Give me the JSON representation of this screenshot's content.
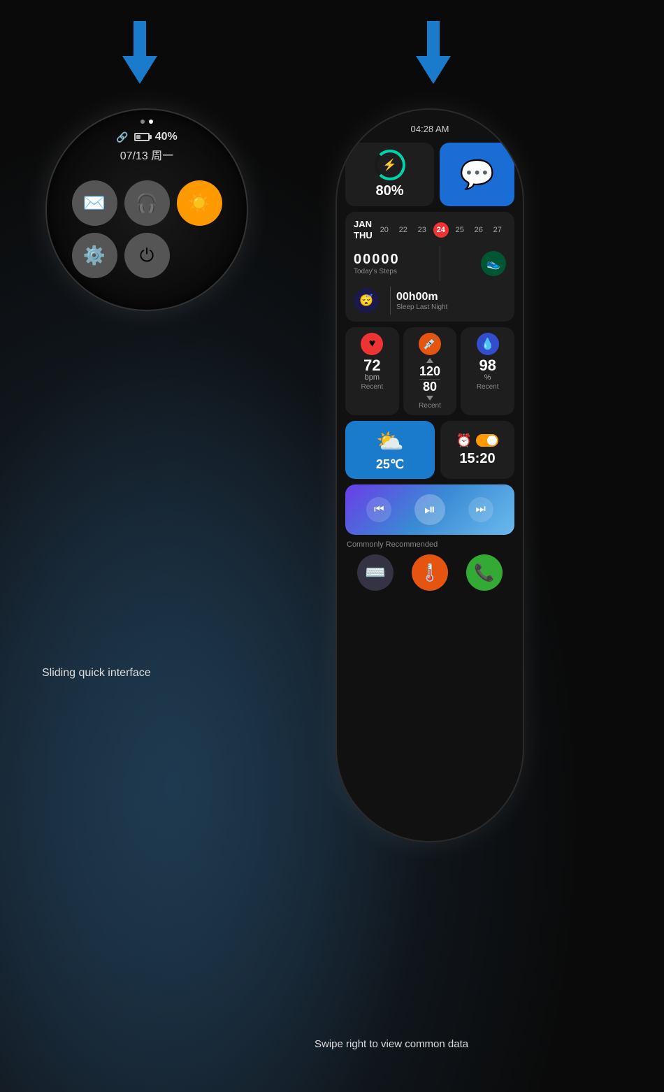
{
  "background": {
    "gradient": "dark runner background"
  },
  "arrows": {
    "left": {
      "color": "#1a7acc"
    },
    "right": {
      "color": "#1a7acc"
    }
  },
  "left_watch": {
    "dots": [
      {
        "active": false
      },
      {
        "active": true
      }
    ],
    "status": {
      "battery_pct": "40%",
      "date": "07/13 周一"
    },
    "icons": [
      {
        "name": "mail",
        "symbol": "✉",
        "bg": "gray"
      },
      {
        "name": "headphone",
        "symbol": "🎧",
        "bg": "gray"
      },
      {
        "name": "brightness",
        "symbol": "☀",
        "bg": "orange"
      },
      {
        "name": "settings",
        "symbol": "⚙",
        "bg": "gray"
      },
      {
        "name": "power",
        "symbol": "⏻",
        "bg": "gray"
      }
    ],
    "caption": "Sliding quick interface"
  },
  "right_watch": {
    "time": "04:28 AM",
    "charge": {
      "pct": "80%",
      "icon": "⚡"
    },
    "message": {
      "icon": "💬"
    },
    "calendar": {
      "month": "JAN",
      "day": "THU",
      "dates": [
        "20",
        "22",
        "23",
        "24",
        "25",
        "26",
        "27"
      ],
      "today_index": 3
    },
    "steps": {
      "count": "00000",
      "label": "Today's Steps",
      "icon": "👟"
    },
    "sleep": {
      "time": "00h00m",
      "label": "Sleep Last Night",
      "icon": "😴"
    },
    "heart": {
      "value": "72",
      "unit": "bpm",
      "sublabel": "Recent",
      "icon": "♥"
    },
    "blood_pressure": {
      "systolic": "120",
      "diastolic": "80",
      "sublabel": "Recent",
      "icon": "💉"
    },
    "oxygen": {
      "value": "98",
      "unit": "%",
      "sublabel": "Recent",
      "icon": "💧"
    },
    "weather": {
      "temp": "25℃",
      "icon": "⛅"
    },
    "alarm": {
      "time": "15:20",
      "icon": "⏰",
      "toggle_on": true
    },
    "music": {
      "prev": "⏮",
      "play_pause": "⏯",
      "next": "⏭"
    },
    "recommended_label": "Commonly Recommended",
    "apps": [
      {
        "name": "keyboard",
        "symbol": "⌨",
        "bg": "#334"
      },
      {
        "name": "thermometer",
        "symbol": "🌡",
        "bg": "#e55510"
      },
      {
        "name": "phone",
        "symbol": "📞",
        "bg": "#3a3"
      }
    ],
    "caption": "Swipe right to view common data"
  }
}
